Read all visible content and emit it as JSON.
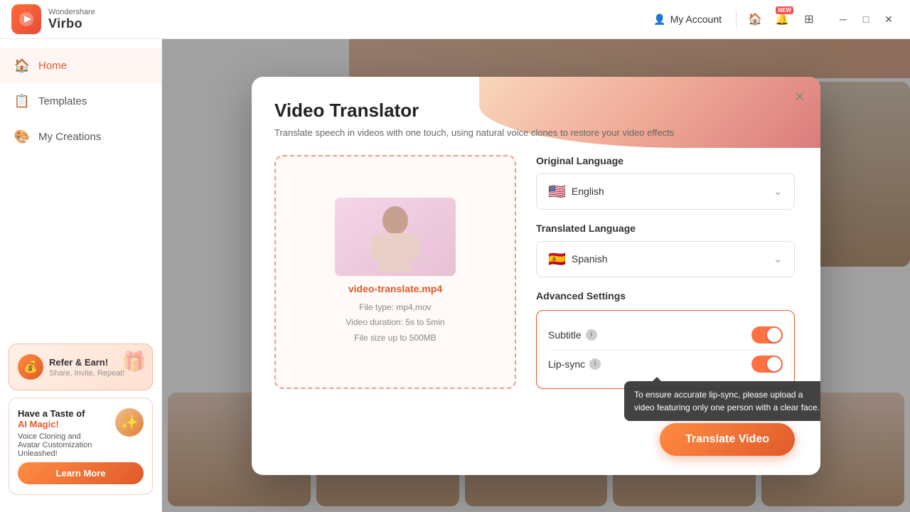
{
  "app": {
    "brand_top": "Wondershare",
    "brand_bottom": "Virbo"
  },
  "titlebar": {
    "my_account": "My Account",
    "new_badge": "NEW"
  },
  "sidebar": {
    "items": [
      {
        "id": "home",
        "label": "Home",
        "icon": "🏠",
        "active": true
      },
      {
        "id": "templates",
        "label": "Templates",
        "icon": "📋",
        "active": false
      },
      {
        "id": "my-creations",
        "label": "My Creations",
        "icon": "🎨",
        "active": false
      }
    ],
    "promo_refer": {
      "title": "Refer & Earn!",
      "subtitle": "Share, Invite, Repeat!"
    },
    "promo_ai": {
      "title": "Have a Taste of",
      "highlight": "AI Magic!",
      "body": "Voice Cloning and\nAvatar Customization Unleashed!",
      "learn_more": "Learn More"
    }
  },
  "modal": {
    "title": "Video Translator",
    "subtitle": "Translate speech in videos with one touch, using natural voice clones to restore your video effects",
    "upload": {
      "file_name": "video-translate.mp4",
      "file_type": "File type: mp4,mov",
      "duration": "Video duration: 5s to 5min",
      "size": "File size up to  500MB"
    },
    "original_language_label": "Original Language",
    "original_language": {
      "flag": "🇺🇸",
      "value": "English"
    },
    "translated_language_label": "Translated Language",
    "translated_language": {
      "flag": "🇪🇸",
      "value": "Spanish"
    },
    "advanced_settings_label": "Advanced Settings",
    "subtitle_label": "Subtitle",
    "lipsync_label": "Lip-sync",
    "tooltip": "To ensure accurate lip-sync, please upload a video featuring only one person with a clear face.",
    "translate_button": "Translate Video"
  }
}
